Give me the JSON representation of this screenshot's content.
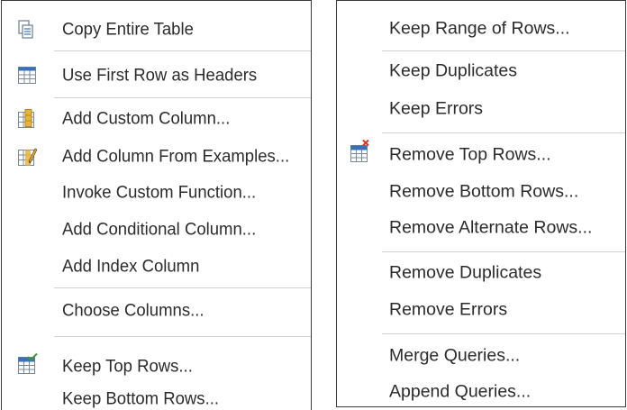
{
  "left_menu": {
    "items": [
      {
        "label": "Copy Entire Table",
        "icon": "copy-table-icon"
      },
      {
        "label": "Use First Row as Headers",
        "icon": "table-header-icon"
      },
      {
        "label": "Add Custom Column...",
        "icon": "custom-column-icon"
      },
      {
        "label": "Add Column From Examples...",
        "icon": "column-from-examples-icon"
      },
      {
        "label": "Invoke Custom Function..."
      },
      {
        "label": "Add Conditional Column..."
      },
      {
        "label": "Add Index Column"
      },
      {
        "label": "Choose Columns..."
      },
      {
        "label": "Keep Top Rows...",
        "icon": "keep-rows-icon"
      },
      {
        "label": "Keep Bottom Rows..."
      }
    ]
  },
  "right_menu": {
    "items": [
      {
        "label": "Keep Range of Rows..."
      },
      {
        "label": "Keep Duplicates"
      },
      {
        "label": "Keep Errors"
      },
      {
        "label": "Remove Top Rows...",
        "icon": "remove-rows-icon"
      },
      {
        "label": "Remove Bottom Rows..."
      },
      {
        "label": "Remove Alternate Rows..."
      },
      {
        "label": "Remove Duplicates"
      },
      {
        "label": "Remove Errors"
      },
      {
        "label": "Merge Queries..."
      },
      {
        "label": "Append Queries..."
      }
    ]
  },
  "colors": {
    "text": "#2b2b2b",
    "border": "#3a3a3a",
    "separator": "#d2d2d2",
    "icon_blue": "#3b6fb6",
    "icon_grid": "#7a8a9c",
    "icon_yellow": "#e8b43a",
    "icon_green": "#3a9a3a",
    "icon_red": "#d93a2b"
  }
}
